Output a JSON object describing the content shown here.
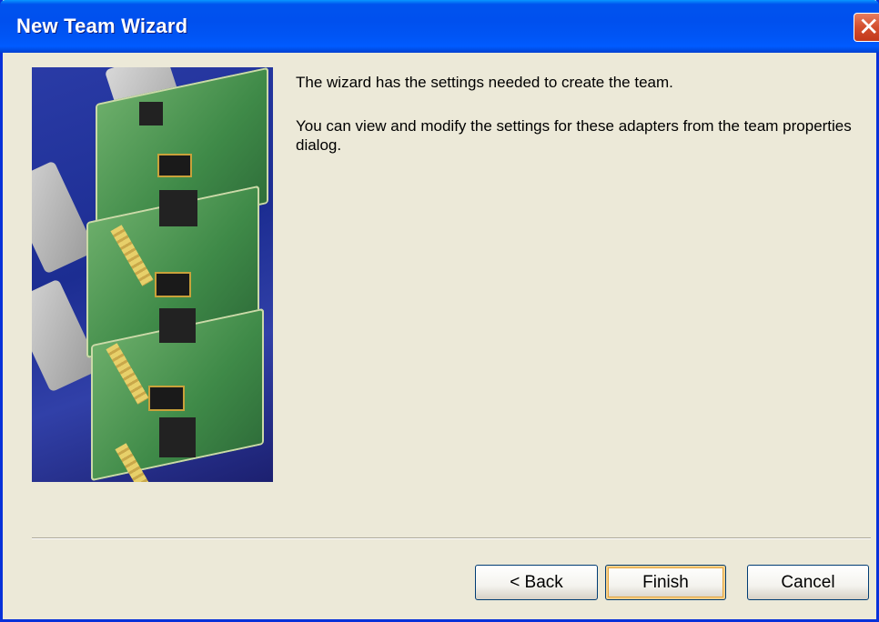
{
  "window": {
    "title": "New Team Wizard"
  },
  "content": {
    "message_1": "The wizard has the settings needed to create the team.",
    "message_2": "You can view and modify the settings for these adapters from the team properties dialog."
  },
  "buttons": {
    "back_label": "< Back",
    "finish_label": "Finish",
    "cancel_label": "Cancel"
  },
  "icons": {
    "close": "close-icon",
    "illustration": "network-adapter-image"
  },
  "colors": {
    "titlebar": "#0055ee",
    "window_bg": "#ece9d8",
    "close_button": "#d34e2d",
    "default_button_highlight": "#e5a53d"
  }
}
